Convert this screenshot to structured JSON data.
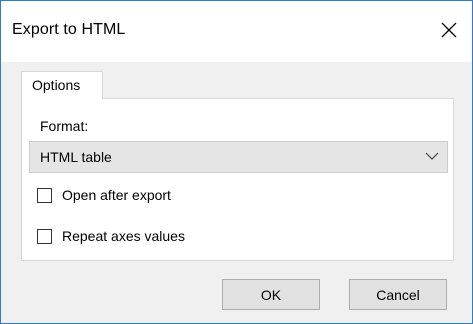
{
  "dialog": {
    "title": "Export to HTML",
    "tab_label": "Options",
    "format_label": "Format:",
    "format_value": "HTML table",
    "checkboxes": [
      {
        "label": "Open after export",
        "checked": false
      },
      {
        "label": "Repeat axes values",
        "checked": false
      }
    ],
    "ok_label": "OK",
    "cancel_label": "Cancel"
  },
  "icons": {
    "close": "close-icon",
    "dropdown": "chevron-down-icon"
  },
  "colors": {
    "window_border": "#2b7bd3",
    "background": "#f0f0f0",
    "select_background": "#e5e5e5"
  }
}
